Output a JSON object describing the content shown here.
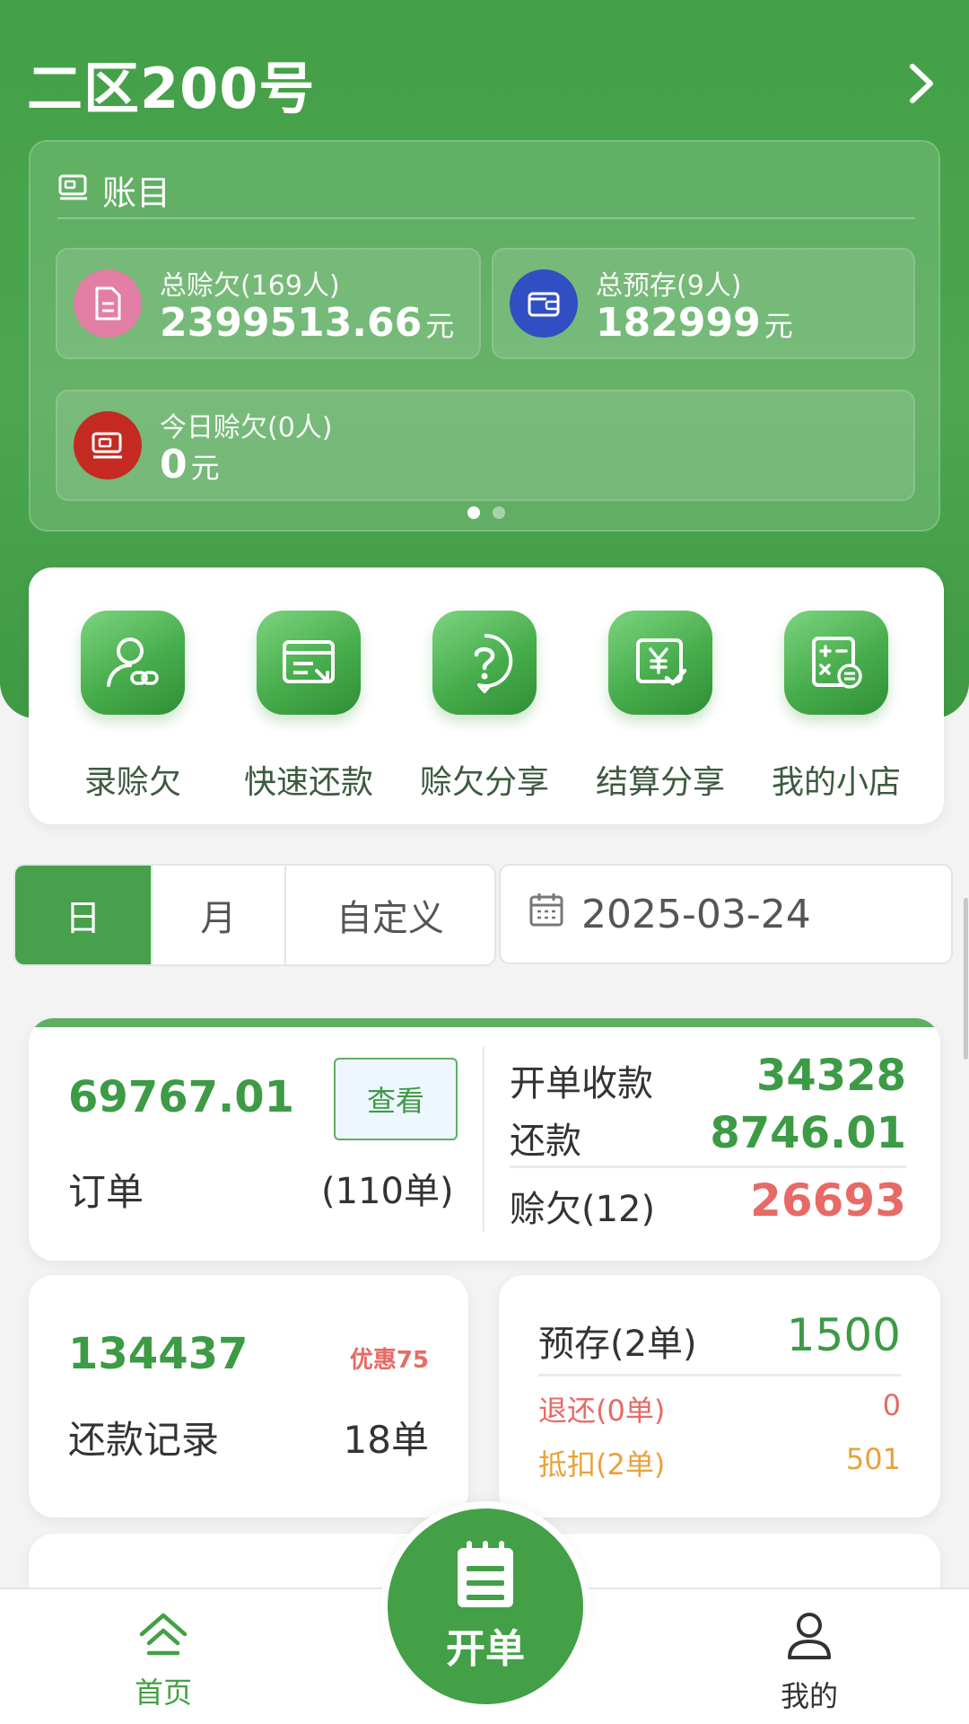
{
  "header": {
    "store_name": "二区200号"
  },
  "account": {
    "title": "账目",
    "total_credit": {
      "label": "总赊欠(169人)",
      "value": "2399513.66",
      "unit": "元"
    },
    "total_deposit": {
      "label": "总预存(9人)",
      "value": "182999",
      "unit": "元"
    },
    "today_credit": {
      "label": "今日赊欠(0人)",
      "value": "0",
      "unit": "元"
    },
    "page_count": 2,
    "active_page": 1
  },
  "quick_actions": [
    {
      "label": "录赊欠",
      "icon": "person-record-icon"
    },
    {
      "label": "快速还款",
      "icon": "card-return-icon"
    },
    {
      "label": "赊欠分享",
      "icon": "question-bubble-icon"
    },
    {
      "label": "结算分享",
      "icon": "yen-check-icon"
    },
    {
      "label": "我的小店",
      "icon": "calculator-icon"
    }
  ],
  "period": {
    "tabs": [
      "日",
      "月",
      "自定义"
    ],
    "active": "日",
    "date": "2025-03-24"
  },
  "orders": {
    "amount": "69767.01",
    "view_label": "查看",
    "label": "订单",
    "count": "(110单)",
    "open_receipt_label": "开单收款",
    "open_receipt_value": "34328",
    "repay_label": "还款",
    "repay_value": "8746.01",
    "credit_label": "赊欠(12)",
    "credit_value": "26693"
  },
  "repayments": {
    "amount": "134437",
    "discount": "优惠75",
    "label": "还款记录",
    "count": "18单"
  },
  "deposits": {
    "label": "预存(2单)",
    "value": "1500",
    "refund_label": "退还(0单)",
    "refund_value": "0",
    "deduct_label": "抵扣(2单)",
    "deduct_value": "501"
  },
  "nav": {
    "home": "首页",
    "create": "开单",
    "mine": "我的"
  },
  "colors": {
    "primary": "#43a047",
    "danger": "#e76a66",
    "warning": "#e8a23b"
  }
}
